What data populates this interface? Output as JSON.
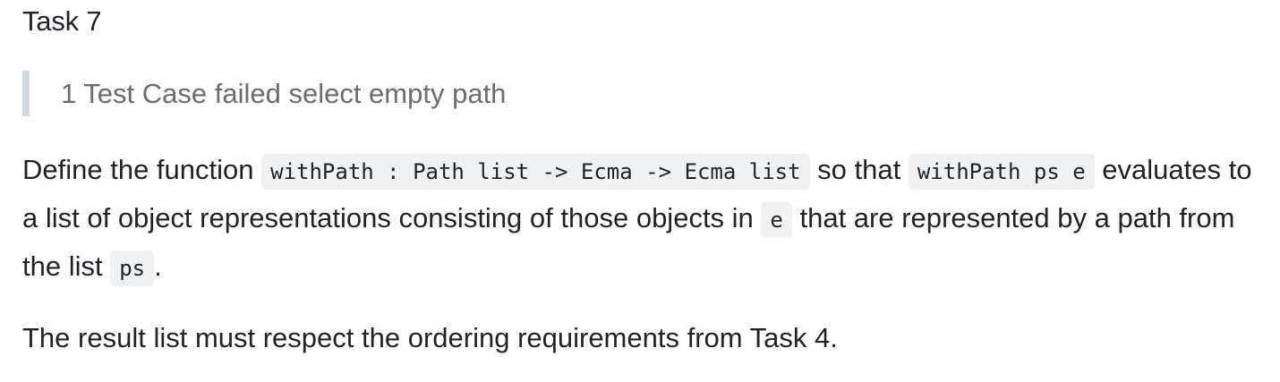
{
  "task": {
    "heading": "Task 7"
  },
  "status": {
    "quote": "1 Test Case failed select empty path"
  },
  "description": {
    "part1": "Define the function ",
    "code_signature": "withPath : Path list -> Ecma -> Ecma list",
    "part2": " so that ",
    "code_call": "withPath ps e",
    "part3": " evaluates to a list of object representations consisting of those objects in ",
    "code_e": "e",
    "part4": " that are represented by a path from the list ",
    "code_ps": "ps",
    "part5": "."
  },
  "note": {
    "text": "The result list must respect the ordering requirements from Task 4."
  }
}
